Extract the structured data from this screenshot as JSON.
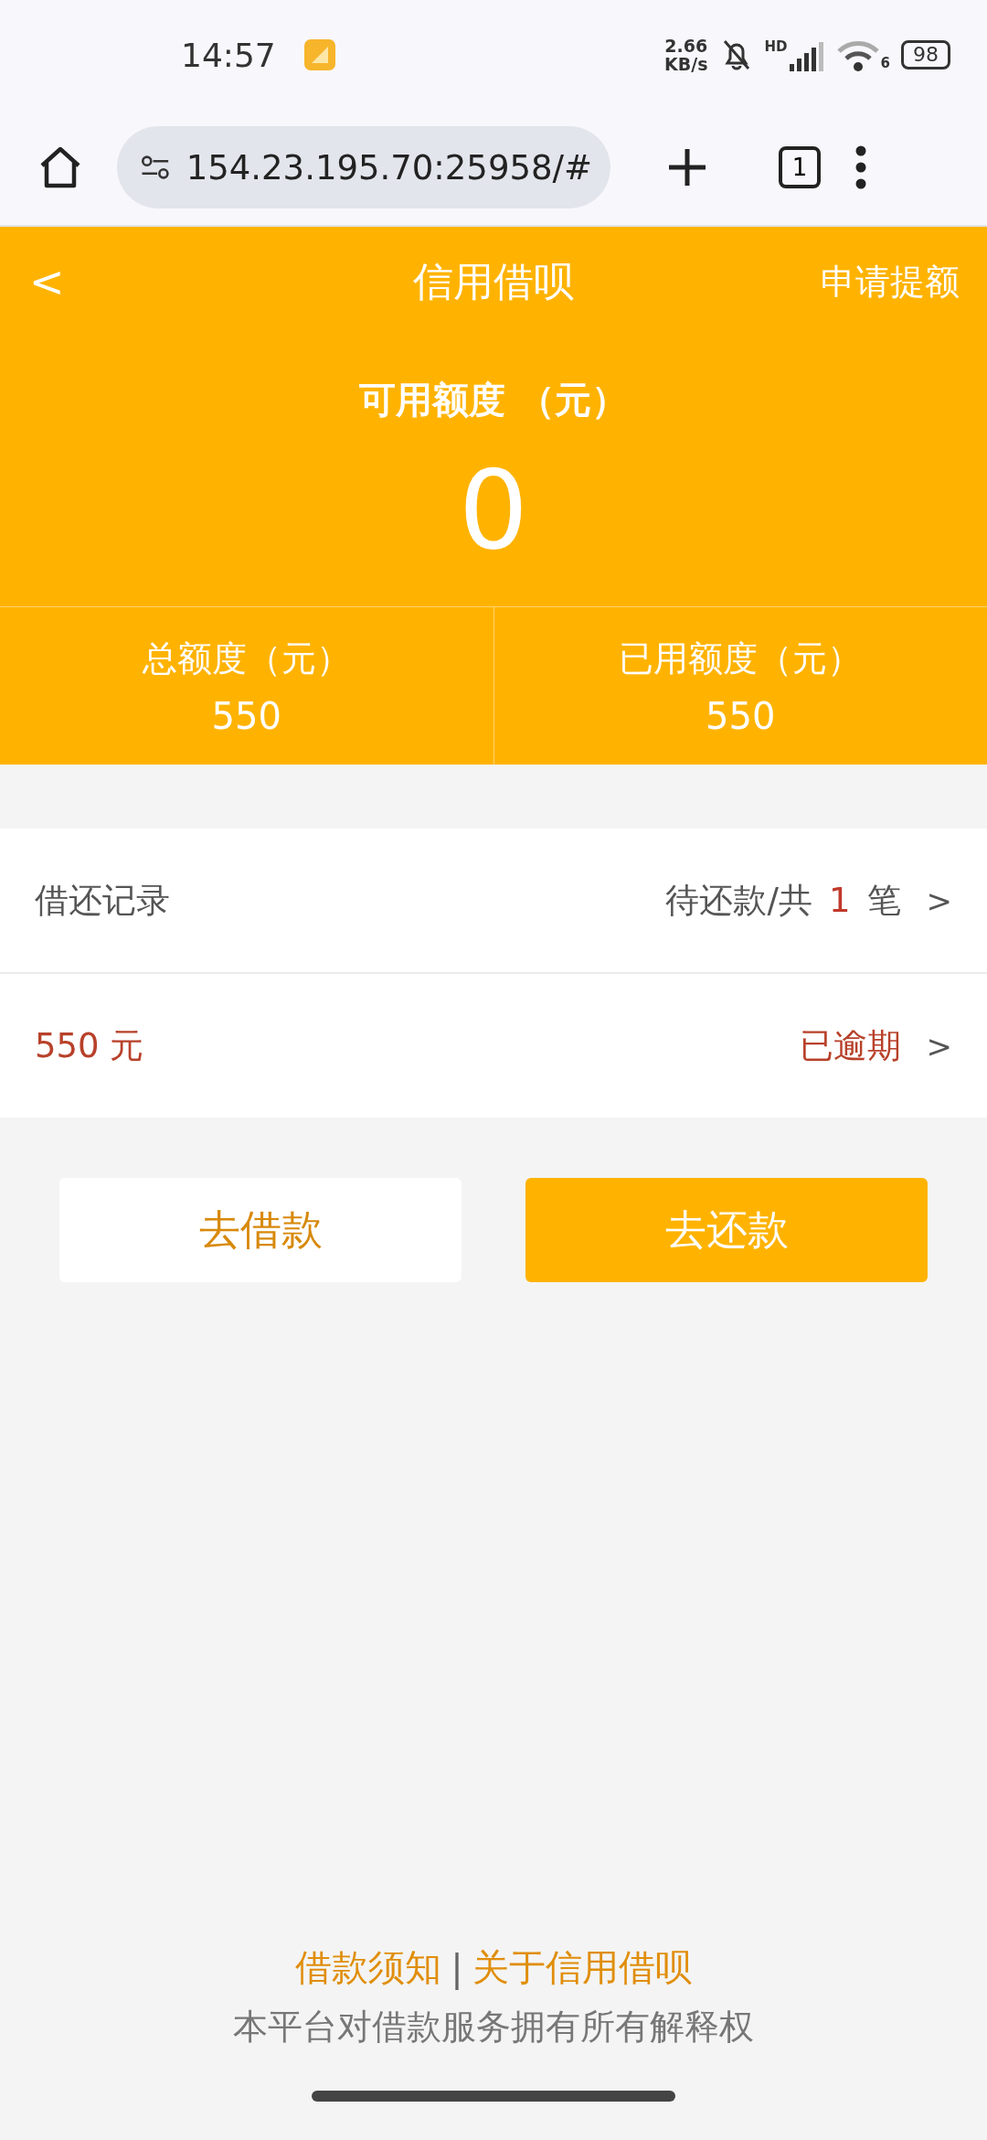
{
  "status_bar": {
    "time": "14:57",
    "speed_value": "2.66",
    "speed_unit": "KB/s",
    "signal_label": "HD",
    "wifi_label": "6",
    "battery": "98"
  },
  "browser": {
    "url": "154.23.195.70:25958/#",
    "tab_count": "1"
  },
  "header": {
    "back": "<",
    "title": "信用借呗",
    "action": "申请提额",
    "available_label": "可用额度 （元）",
    "available_value": "0",
    "stats": [
      {
        "label": "总额度（元）",
        "value": "550"
      },
      {
        "label": "已用额度（元）",
        "value": "550"
      }
    ]
  },
  "records": {
    "label": "借还记录",
    "prefix": "待还款/共",
    "count": "1",
    "suffix": "笔",
    "arrow": ">"
  },
  "loan": {
    "amount": "550 元",
    "status": "已逾期",
    "arrow": ">"
  },
  "buttons": [
    {
      "label": "去借款",
      "kind": "secondary"
    },
    {
      "label": "去还款",
      "kind": "primary"
    }
  ],
  "footer": {
    "links": [
      "借款须知",
      "关于信用借呗"
    ],
    "separator": "|",
    "disclaimer": "本平台对借款服务拥有所有解释权"
  }
}
